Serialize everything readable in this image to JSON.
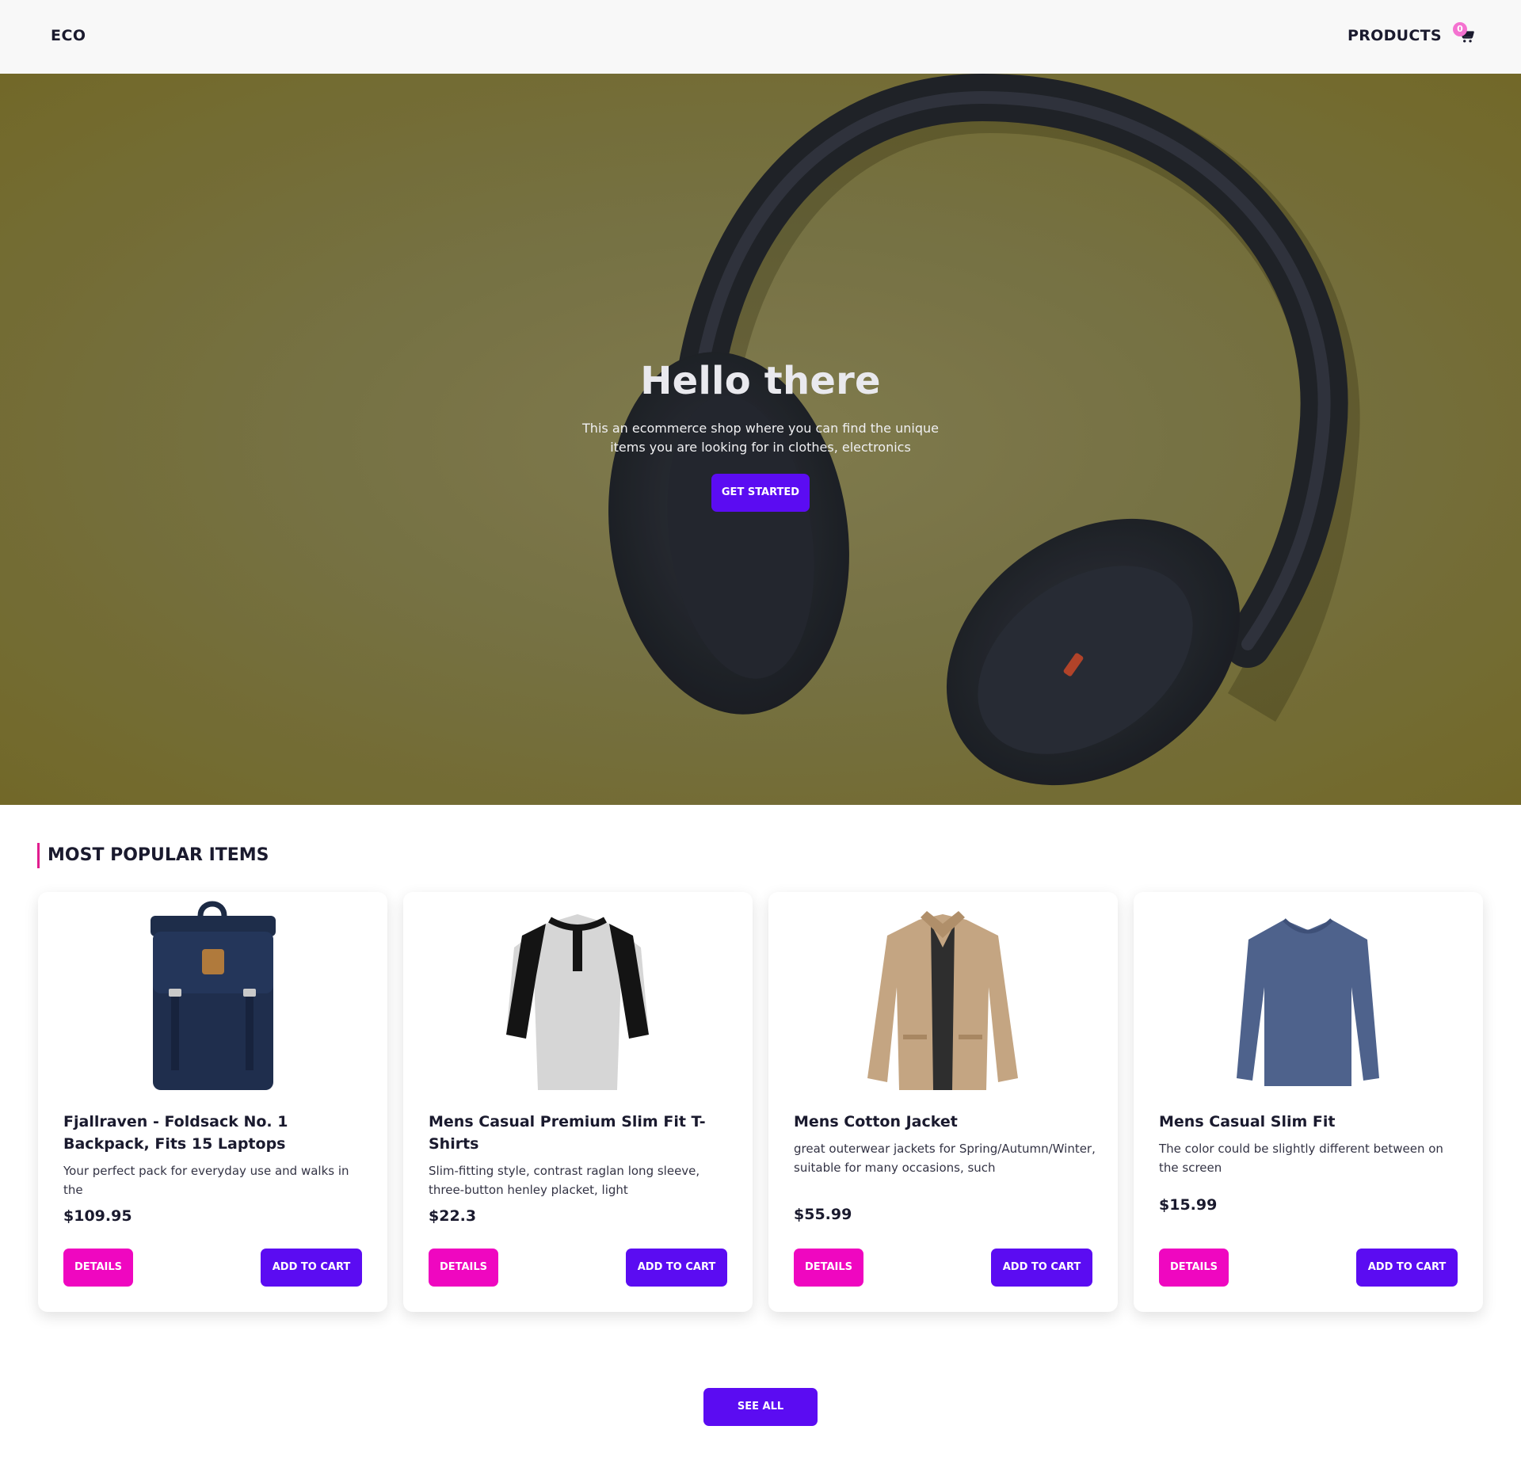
{
  "header": {
    "logo": "ECO",
    "nav_products": "PRODUCTS",
    "cart_count": "0"
  },
  "hero": {
    "title": "Hello there",
    "text": "This an ecommerce shop where you can find the unique items you are looking for in clothes, electronics",
    "cta": "GET STARTED"
  },
  "section": {
    "title": "MOST POPULAR ITEMS"
  },
  "products": [
    {
      "title": "Fjallraven - Foldsack No. 1 Backpack, Fits 15 Laptops",
      "description": "Your perfect pack for everyday use and walks in the",
      "price": "$109.95",
      "details_label": "DETAILS",
      "cart_label": "ADD TO CART"
    },
    {
      "title": "Mens Casual Premium Slim Fit T-Shirts",
      "description": "Slim-fitting style, contrast raglan long sleeve, three-button henley placket, light",
      "price": "$22.3",
      "details_label": "DETAILS",
      "cart_label": "ADD TO CART"
    },
    {
      "title": "Mens Cotton Jacket",
      "description": "great outerwear jackets for Spring/Autumn/Winter, suitable for many occasions, such",
      "price": "$55.99",
      "details_label": "DETAILS",
      "cart_label": "ADD TO CART"
    },
    {
      "title": "Mens Casual Slim Fit",
      "description": "The color could be slightly different between on the screen",
      "price": "$15.99",
      "details_label": "DETAILS",
      "cart_label": "ADD TO CART"
    }
  ],
  "see_all": "SEE ALL",
  "colors": {
    "primary": "#5b0cf2",
    "accent_pink": "#ef07c0",
    "badge_pink": "#f472d0",
    "header_bg": "#f8f8f8",
    "hero_bg": "#7f7a4c"
  }
}
